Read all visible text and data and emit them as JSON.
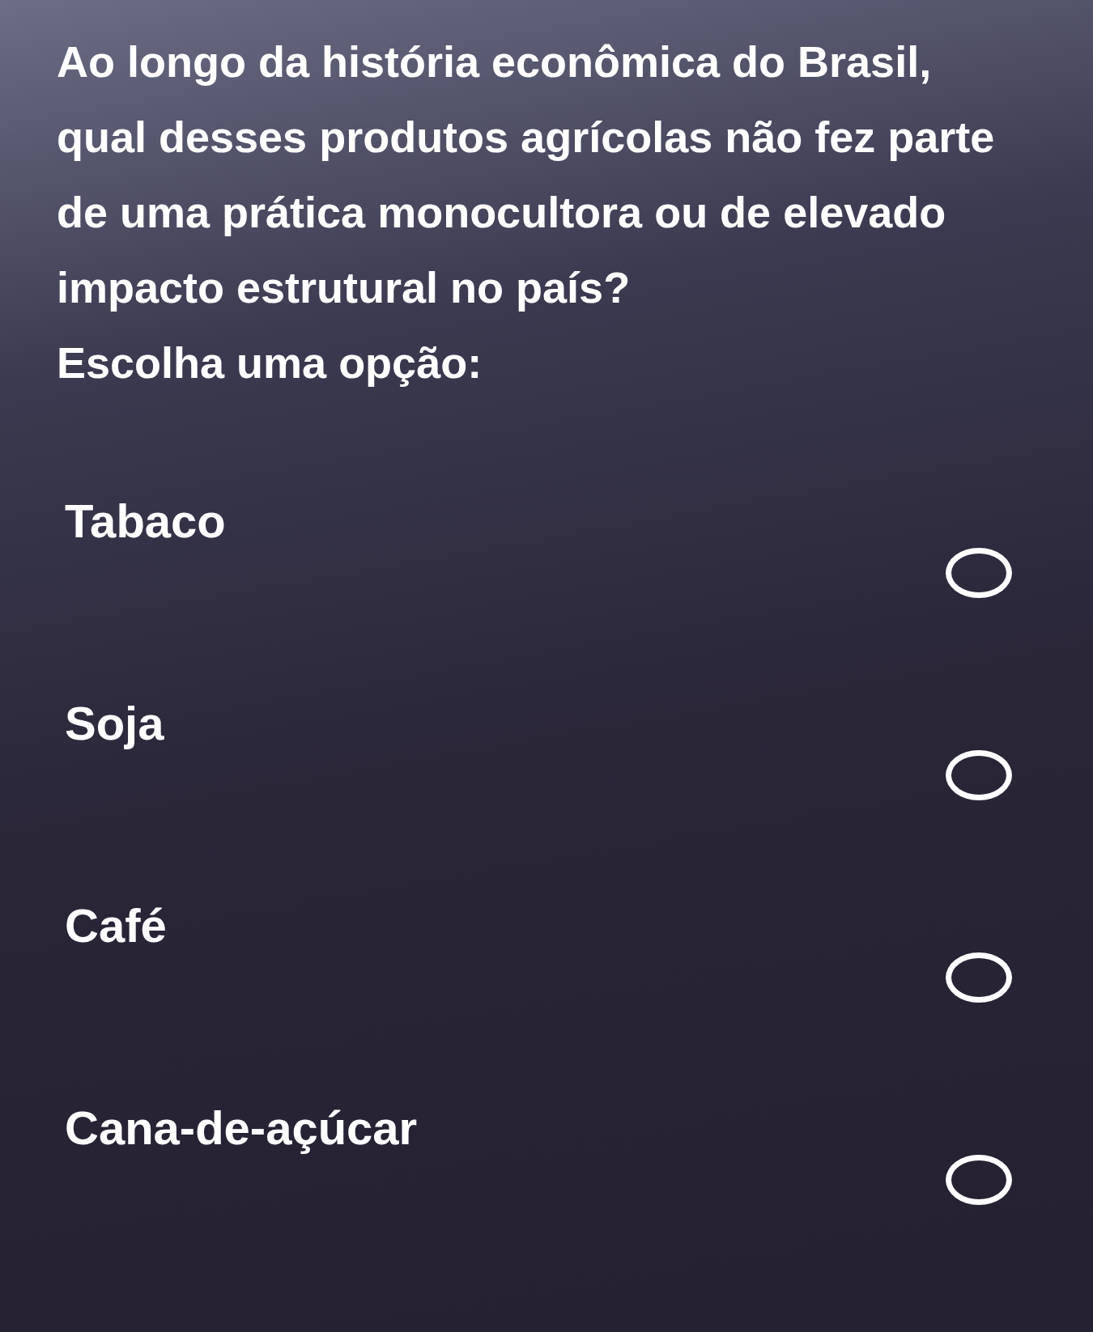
{
  "question": "Ao longo da história econômica do Brasil, qual desses produtos agrícolas não fez parte de uma prática monocultora ou de elevado impacto estrutural no país?",
  "prompt": "Escolha uma opção:",
  "options": [
    {
      "label": "Tabaco",
      "selected": false
    },
    {
      "label": "Soja",
      "selected": false
    },
    {
      "label": "Café",
      "selected": false
    },
    {
      "label": "Cana-de-açúcar",
      "selected": false
    }
  ]
}
